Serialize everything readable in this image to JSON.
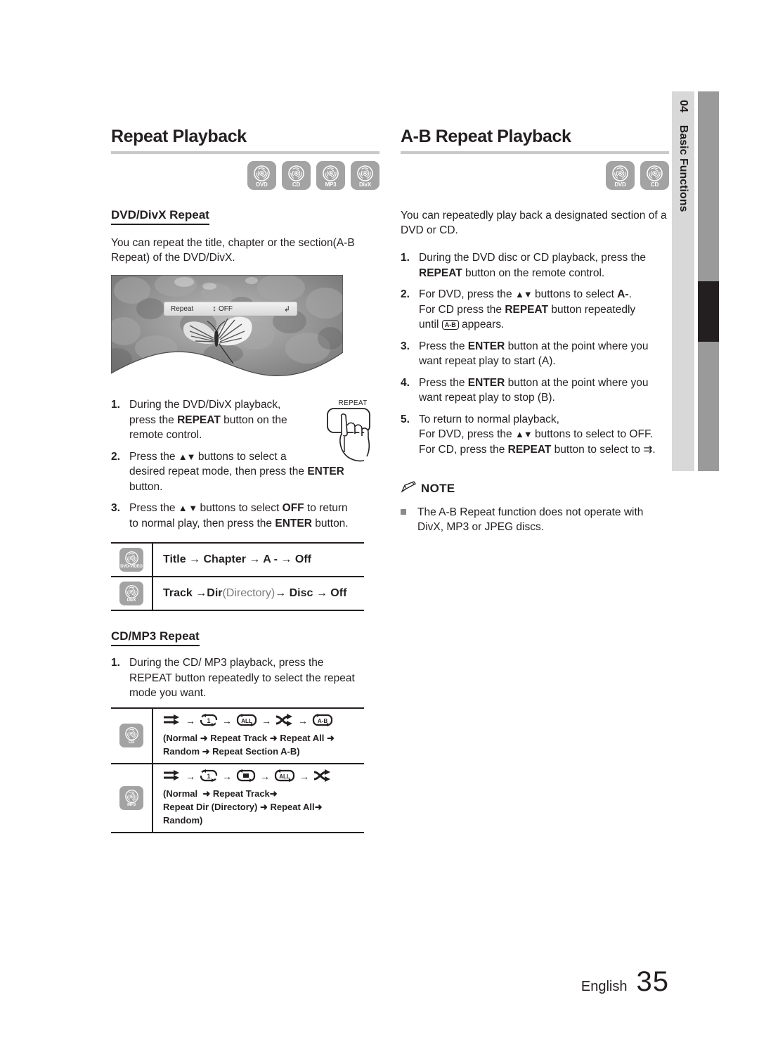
{
  "sidetab": {
    "number": "04",
    "label": "Basic Functions"
  },
  "footer": {
    "language": "English",
    "page": "35"
  },
  "left": {
    "title": "Repeat Playback",
    "badges": [
      {
        "name": "dvd-badge",
        "label": "DVD"
      },
      {
        "name": "cd-badge",
        "label": "CD"
      },
      {
        "name": "mp3-badge",
        "label": "MP3"
      },
      {
        "name": "divx-badge",
        "label": "DivX"
      }
    ],
    "subtitle": "DVD/DivX Repeat",
    "intro": "You can repeat the title, chapter or the section(A-B Repeat) of the DVD/DivX.",
    "osd": {
      "label": "Repeat",
      "updown": "↕",
      "value": "OFF",
      "enter": "↲"
    },
    "remote_button_label": "REPEAT",
    "steps": [
      {
        "n": "1.",
        "html": "During the DVD/DivX playback,<br>press the <b>REPEAT</b> button on the<br>remote control."
      },
      {
        "n": "2.",
        "html": "Press the <span class=\"ud\">▲▼</span> buttons to select a<br>desired repeat mode, then press the <b>ENTER</b><br>button."
      },
      {
        "n": "3.",
        "html": "Press the <span class=\"ud\">▲ ▼</span> buttons to select <b>OFF</b> to return<br>to normal play, then press the <b>ENTER</b> button."
      }
    ],
    "table1": [
      {
        "icon": "DVD-VIDEO",
        "html": "Title → Chapter → A - → Off"
      },
      {
        "icon": "DivX",
        "html": "Track → <b>Dir</b> <span class=\"light\">(Directory)</span> → Disc → Off"
      }
    ],
    "subtitle2": "CD/MP3 Repeat",
    "steps2": [
      {
        "n": "1.",
        "html": "During the CD/ MP3 playback, press the<br>REPEAT button repeatedly to select the repeat<br>mode you want."
      }
    ],
    "table2": [
      {
        "icon": "CD",
        "glyphs": [
          "normal",
          "repeat-track",
          "repeat-all",
          "random",
          "repeat-ab"
        ],
        "seq": "(Normal ➜ Repeat Track ➜ Repeat All ➜<br>Random ➜ Repeat Section A-B)"
      },
      {
        "icon": "MP3",
        "glyphs": [
          "normal",
          "repeat-track",
          "repeat-dir",
          "repeat-all",
          "random"
        ],
        "seq": "(Normal  ➜ Repeat Track➜<br>Repeat Dir (Directory) ➜ Repeat All➜ Random)"
      }
    ]
  },
  "right": {
    "title": "A-B Repeat Playback",
    "badges": [
      {
        "name": "dvd-badge",
        "label": "DVD"
      },
      {
        "name": "cd-badge",
        "label": "CD"
      }
    ],
    "intro": "You can repeatedly play back a designated section of a DVD or CD.",
    "steps": [
      {
        "n": "1.",
        "html": "During the DVD disc or CD playback, press the<br><b>REPEAT</b> button on the remote control."
      },
      {
        "n": "2.",
        "html": "For DVD, press the <span class=\"ud\">▲▼</span> buttons to select <b>A-</b>.<br>For CD press the <b>REPEAT</b> button repeatedly<br>until <span class=\"ab-glyph\">A-B</span> appears."
      },
      {
        "n": "3.",
        "html": "Press the <b>ENTER</b> button at the point where you<br>want repeat play to start (A)."
      },
      {
        "n": "4.",
        "html": "Press the <b>ENTER</b> button at the point where you<br>want repeat play to stop (B)."
      },
      {
        "n": "5.",
        "html": "To return to normal playback,<br>For DVD, press the <span class=\"ud\">▲▼</span> buttons to select to OFF.<br>For CD, press the <b>REPEAT</b> button to select to ⇉."
      }
    ],
    "note": {
      "label": "NOTE",
      "items": [
        "The A-B Repeat function does not operate with DivX, MP3 or JPEG discs."
      ]
    }
  }
}
